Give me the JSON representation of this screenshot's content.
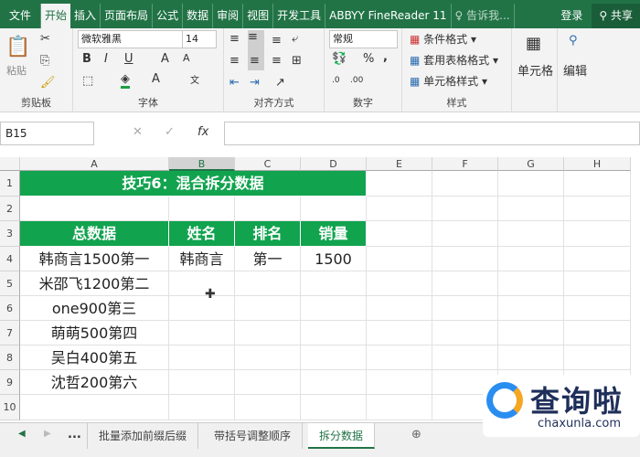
{
  "title_tabs": [
    "文件",
    "开始",
    "插入",
    "页面布局",
    "公式",
    "数据",
    "审阅",
    "视图",
    "开发工具",
    "ABBYY FineReader 11"
  ],
  "tell_me": "告诉我...",
  "login": "登录",
  "share": "共享",
  "ribbon": {
    "clipboard": {
      "label": "剪贴板",
      "paste": "粘贴"
    },
    "font": {
      "label": "字体",
      "font_name": "微软雅黑",
      "font_size": "14",
      "bold": "B",
      "italic": "I",
      "underline": "U"
    },
    "alignment": {
      "label": "对齐方式"
    },
    "number": {
      "label": "数字",
      "format": "常规",
      "percent": "%",
      "comma": ","
    },
    "styles": {
      "label": "样式",
      "conditional": "条件格式",
      "table": "套用表格格式",
      "cell_styles": "单元格样式"
    },
    "cells": {
      "label": "单元格"
    },
    "editing": {
      "label": "编辑"
    }
  },
  "name_box": "B15",
  "fx": "fx",
  "columns": [
    "A",
    "B",
    "C",
    "D",
    "E",
    "F",
    "G",
    "H"
  ],
  "rows": [
    "1",
    "2",
    "3",
    "4",
    "5",
    "6",
    "7",
    "8",
    "9",
    "10"
  ],
  "cells": {
    "title": "技巧6：混合拆分数据",
    "headers": [
      "总数据",
      "姓名",
      "排名",
      "销量"
    ],
    "row4": [
      "韩商言1500第一",
      "韩商言",
      "第一",
      "1500"
    ],
    "col_a": [
      "米邵飞1200第二",
      "one900第三",
      "萌萌500第四",
      "吴白400第五",
      "沈哲200第六"
    ]
  },
  "sheets": [
    "批量添加前缀后缀",
    "带括号调整顺序",
    "拆分数据"
  ],
  "sheet_more": "...",
  "watermark": {
    "text": "查询啦",
    "url": "chaxunla.com"
  },
  "colors": {
    "accent": "#217346",
    "header_fill": "#12a34f"
  }
}
